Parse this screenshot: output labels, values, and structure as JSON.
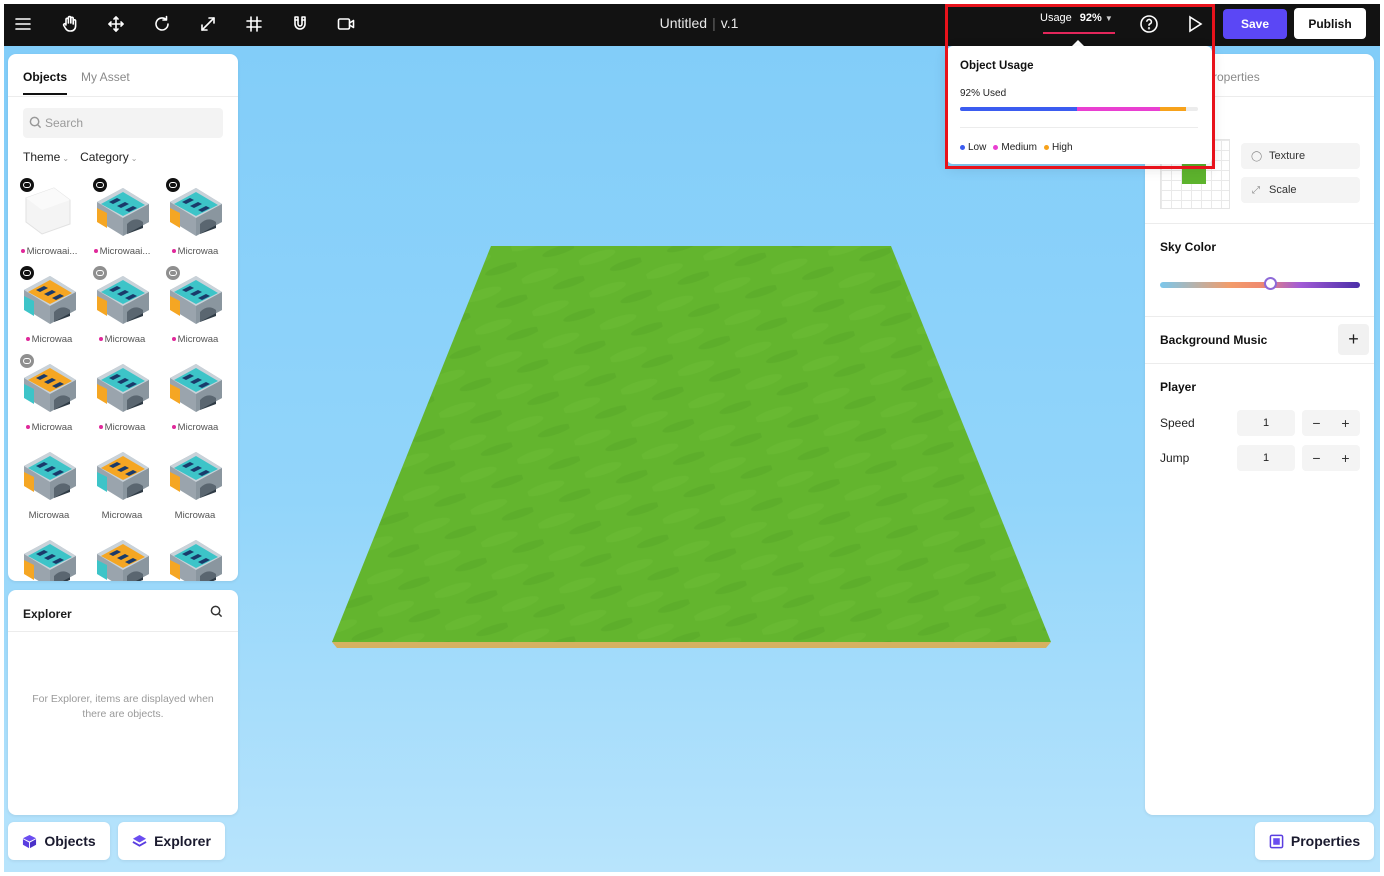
{
  "app": {
    "title": "Untitled",
    "version": "v.1"
  },
  "toolbar": {
    "tools": [
      {
        "name": "menu",
        "icon": "hamburger-menu-icon"
      },
      {
        "name": "hand",
        "icon": "hand-pan-icon"
      },
      {
        "name": "move",
        "icon": "move-arrows-icon"
      },
      {
        "name": "rotate",
        "icon": "rotate-icon"
      },
      {
        "name": "scale",
        "icon": "scale-diagonal-icon"
      },
      {
        "name": "grid",
        "icon": "grid-hash-icon"
      },
      {
        "name": "magnet",
        "icon": "magnet-icon"
      },
      {
        "name": "camera",
        "icon": "video-camera-icon"
      }
    ],
    "usage_label": "Usage",
    "usage_value": "92%",
    "save_label": "Save",
    "publish_label": "Publish"
  },
  "usage_popover": {
    "title": "Object Usage",
    "used_text": "92% Used",
    "used_fraction": 0.92,
    "segments": [
      {
        "level": "low",
        "fraction": 0.49,
        "color": "#3b5cf0"
      },
      {
        "level": "medium",
        "fraction": 0.35,
        "color": "#e93fd1"
      },
      {
        "level": "high",
        "fraction": 0.11,
        "color": "#f7a21b"
      }
    ],
    "legend": [
      {
        "label": "Low",
        "color": "#3b5cf0"
      },
      {
        "label": "Medium",
        "color": "#e93fd1"
      },
      {
        "label": "High",
        "color": "#f7a21b"
      }
    ]
  },
  "objects_panel": {
    "tabs": [
      {
        "label": "Objects",
        "active": true
      },
      {
        "label": "My Asset",
        "active": false
      }
    ],
    "search_placeholder": "Search",
    "filters": [
      "Theme",
      "Category"
    ],
    "assets": [
      {
        "label": "Microwaai...",
        "badge": "dark",
        "dot": true,
        "style": "white"
      },
      {
        "label": "Microwaai...",
        "badge": "dark",
        "dot": true,
        "style": "teal"
      },
      {
        "label": "Microwaa",
        "badge": "dark",
        "dot": true,
        "style": "teal"
      },
      {
        "label": "Microwaa",
        "badge": "dark",
        "dot": true,
        "style": "orange"
      },
      {
        "label": "Microwaa",
        "badge": "grey",
        "dot": true,
        "style": "teal"
      },
      {
        "label": "Microwaa",
        "badge": "grey",
        "dot": true,
        "style": "teal"
      },
      {
        "label": "Microwaa",
        "badge": "grey",
        "dot": true,
        "style": "orange"
      },
      {
        "label": "Microwaa",
        "badge": "",
        "dot": true,
        "style": "teal"
      },
      {
        "label": "Microwaa",
        "badge": "",
        "dot": true,
        "style": "teal"
      },
      {
        "label": "Microwaa",
        "badge": "",
        "dot": false,
        "style": "teal"
      },
      {
        "label": "Microwaa",
        "badge": "",
        "dot": false,
        "style": "orange"
      },
      {
        "label": "Microwaa",
        "badge": "",
        "dot": false,
        "style": "teal"
      },
      {
        "label": "",
        "badge": "",
        "dot": false,
        "style": "teal"
      },
      {
        "label": "",
        "badge": "",
        "dot": false,
        "style": "orange"
      },
      {
        "label": "",
        "badge": "",
        "dot": false,
        "style": "teal"
      }
    ]
  },
  "explorer_panel": {
    "title": "Explorer",
    "empty_text": "For Explorer, items are displayed when there are objects."
  },
  "bottom_buttons": {
    "objects_label": "Objects",
    "explorer_label": "Explorer",
    "properties_label": "Properties"
  },
  "properties_panel": {
    "tab_label": "roperties",
    "texture_label": "Texture",
    "scale_label": "Scale",
    "sky_color_title": "Sky Color",
    "sky_color_position": 0.55,
    "background_music_title": "Background Music",
    "player_title": "Player",
    "speed_label": "Speed",
    "speed_value": "1",
    "jump_label": "Jump",
    "jump_value": "1",
    "ground_color": "#5db32d"
  },
  "colors": {
    "accent": "#5b47f5",
    "usage_underline": "#e3265b",
    "highlight": "#e8121b",
    "ground": "#63b52e",
    "ground_edge": "#d6b161"
  }
}
